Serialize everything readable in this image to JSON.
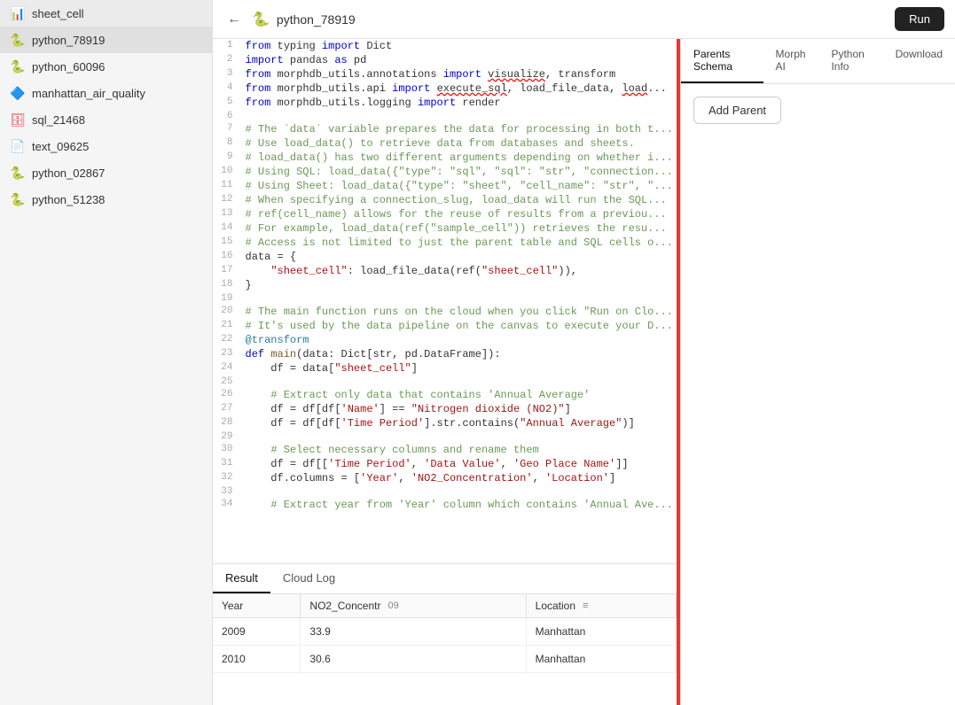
{
  "sidebar": {
    "items": [
      {
        "id": "sheet_cell",
        "label": "sheet_cell",
        "icon": "sheet",
        "active": false
      },
      {
        "id": "python_78919",
        "label": "python_78919",
        "icon": "python",
        "active": true
      },
      {
        "id": "python_60096",
        "label": "python_60096",
        "icon": "python",
        "active": false
      },
      {
        "id": "manhattan_air_quality",
        "label": "manhattan_air_quality",
        "icon": "manhattan",
        "active": false
      },
      {
        "id": "sql_21468",
        "label": "sql_21468",
        "icon": "sql",
        "active": false
      },
      {
        "id": "text_09625",
        "label": "text_09625",
        "icon": "text",
        "active": false
      },
      {
        "id": "python_02867",
        "label": "python_02867",
        "icon": "python",
        "active": false
      },
      {
        "id": "python_51238",
        "label": "python_51238",
        "icon": "python",
        "active": false
      }
    ]
  },
  "header": {
    "title": "python_78919",
    "run_label": "Run"
  },
  "right_panel": {
    "tabs": [
      {
        "id": "parents_schema",
        "label": "Parents Schema",
        "active": true
      },
      {
        "id": "morph_ai",
        "label": "Morph AI",
        "active": false
      },
      {
        "id": "python_info",
        "label": "Python Info",
        "active": false
      },
      {
        "id": "download",
        "label": "Download",
        "active": false
      }
    ],
    "add_parent_label": "Add Parent"
  },
  "bottom": {
    "tabs": [
      {
        "id": "result",
        "label": "Result",
        "active": true
      },
      {
        "id": "cloud_log",
        "label": "Cloud Log",
        "active": false
      }
    ],
    "table": {
      "columns": [
        {
          "id": "year",
          "label": "Year",
          "has_icon": false
        },
        {
          "id": "no2",
          "label": "NO2_Concentr",
          "has_icon": true,
          "icon": "09"
        },
        {
          "id": "location",
          "label": "Location",
          "has_icon": true,
          "icon": "≡"
        }
      ],
      "rows": [
        {
          "year": "2009",
          "no2": "33.9",
          "location": "Manhattan"
        },
        {
          "year": "2010",
          "no2": "30.6",
          "location": "Manhattan"
        }
      ]
    }
  },
  "code": {
    "lines": [
      {
        "num": "1",
        "html": "<span class='kw'>from</span> typing <span class='kw'>import</span> Dict"
      },
      {
        "num": "2",
        "html": "<span class='kw'>import</span> pandas <span class='kw'>as</span> pd"
      },
      {
        "num": "3",
        "html": "<span class='kw'>from</span> morphdb_utils.annotations <span class='kw'>import</span> <span class='err'>visualize</span>, transform"
      },
      {
        "num": "4",
        "html": "<span class='kw'>from</span> morphdb_utils.api <span class='kw'>import</span> <span class='err'>execute_sql</span>, load_file_data, <span class='err'>load</span>..."
      },
      {
        "num": "5",
        "html": "<span class='kw'>from</span> morphdb_utils.logging <span class='kw'>import</span> render"
      },
      {
        "num": "6",
        "html": ""
      },
      {
        "num": "7",
        "html": "<span class='cm'># The `data` variable prepares the data for processing in both t...</span>"
      },
      {
        "num": "8",
        "html": "<span class='cm'># Use load_data() to retrieve data from databases and sheets.</span>"
      },
      {
        "num": "9",
        "html": "<span class='cm'># load_data() has two different arguments depending on whether i...</span>"
      },
      {
        "num": "10",
        "html": "<span class='cm'># Using SQL: load_data({\"type\": \"sql\", \"sql\": \"str\", \"connection...</span>"
      },
      {
        "num": "11",
        "html": "<span class='cm'># Using Sheet: load_data({\"type\": \"sheet\", \"cell_name\": \"str\", \"...</span>"
      },
      {
        "num": "12",
        "html": "<span class='cm'># When specifying a connection_slug, load_data will run the SQL...</span>"
      },
      {
        "num": "13",
        "html": "<span class='cm'># ref(cell_name) allows for the reuse of results from a previou...</span>"
      },
      {
        "num": "14",
        "html": "<span class='cm'># For example, load_data(ref(\"sample_cell\")) retrieves the resu...</span>"
      },
      {
        "num": "15",
        "html": "<span class='cm'># Access is not limited to just the parent table and SQL cells o...</span>"
      },
      {
        "num": "16",
        "html": "data = {"
      },
      {
        "num": "17",
        "html": "    <span class='str'>\"sheet_cell\"</span>: load_file_data(ref(<span class='str'>\"sheet_cell\"</span>)),"
      },
      {
        "num": "18",
        "html": "}"
      },
      {
        "num": "19",
        "html": ""
      },
      {
        "num": "20",
        "html": "<span class='cm'># The main function runs on the cloud when you click \"Run on Clo...</span>"
      },
      {
        "num": "21",
        "html": "<span class='cm'># It's used by the data pipeline on the canvas to execute your D...</span>"
      },
      {
        "num": "22",
        "html": "<span class='dec'>@transform</span>"
      },
      {
        "num": "23",
        "html": "<span class='kw'>def</span> <span class='fn'>main</span>(data: Dict[str, pd.DataFrame]):"
      },
      {
        "num": "24",
        "html": "    df = data[<span class='str'>\"sheet_cell\"</span>]"
      },
      {
        "num": "25",
        "html": ""
      },
      {
        "num": "26",
        "html": "    <span class='cm'># Extract only data that contains 'Annual Average'</span>"
      },
      {
        "num": "27",
        "html": "    df = df[df[<span class='str'>'Name'</span>] == <span class='str'>\"Nitrogen dioxide (NO2)\"</span>]"
      },
      {
        "num": "28",
        "html": "    df = df[df[<span class='str'>'Time Period'</span>].str.contains(<span class='str'>\"Annual Average\"</span>)]"
      },
      {
        "num": "29",
        "html": ""
      },
      {
        "num": "30",
        "html": "    <span class='cm'># Select necessary columns and rename them</span>"
      },
      {
        "num": "31",
        "html": "    df = df[[<span class='str'>'Time Period'</span>, <span class='str'>'Data Value'</span>, <span class='str'>'Geo Place Name'</span>]]"
      },
      {
        "num": "32",
        "html": "    df.columns = [<span class='str'>'Year'</span>, <span class='str'>'NO2_Concentration'</span>, <span class='str'>'Location'</span>]"
      },
      {
        "num": "33",
        "html": ""
      },
      {
        "num": "34",
        "html": "    <span class='cm'># Extract year from 'Year' column which contains 'Annual Ave...</span>"
      }
    ]
  }
}
